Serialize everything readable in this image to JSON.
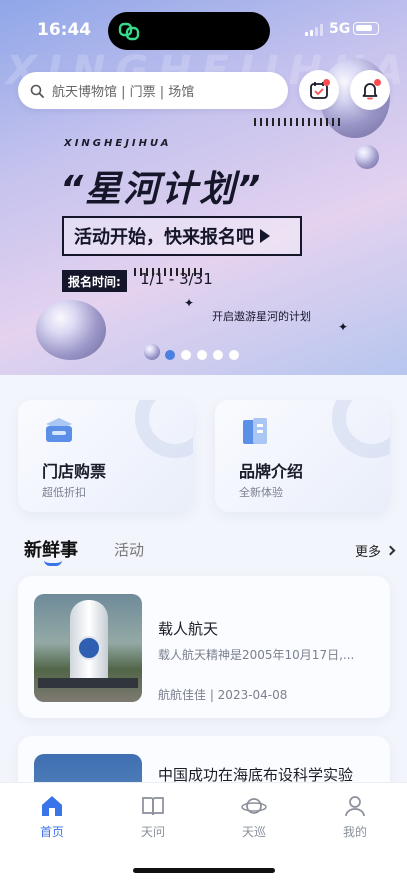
{
  "status_bar": {
    "time": "16:44",
    "network": "5G"
  },
  "search": {
    "placeholder": "航天博物馆 | 门票 | 场馆"
  },
  "banner": {
    "watermark": "XINGHEJIHUA",
    "brand": "XINGHEJIHUA",
    "title": "“星河计划”",
    "slogan": "活动开始，快来报名吧",
    "date_label": "报名时间:",
    "date_value": "1/1 - 3/31",
    "subtitle": "开启遨游星河的计划",
    "slides_total": 5,
    "slide_active": 1
  },
  "cards": [
    {
      "title": "门店购票",
      "subtitle": "超低折扣",
      "icon": "ticket-box-icon"
    },
    {
      "title": "品牌介绍",
      "subtitle": "全新体验",
      "icon": "brand-book-icon"
    }
  ],
  "tabs": {
    "active": "新鲜事",
    "other": "活动",
    "more": "更多"
  },
  "news": [
    {
      "title": "载人航天",
      "desc": "载人航天精神是2005年10月17日,...",
      "meta": "航航佳佳 | 2023-04-08"
    },
    {
      "title": "中国成功在海底布设科学实验"
    }
  ],
  "nav": [
    {
      "label": "首页",
      "icon": "home-icon",
      "active": true
    },
    {
      "label": "天问",
      "icon": "book-icon",
      "active": false
    },
    {
      "label": "天巡",
      "icon": "planet-icon",
      "active": false
    },
    {
      "label": "我的",
      "icon": "user-icon",
      "active": false
    }
  ],
  "colors": {
    "accent": "#3b73e8",
    "badge": "#ff4d4f"
  }
}
